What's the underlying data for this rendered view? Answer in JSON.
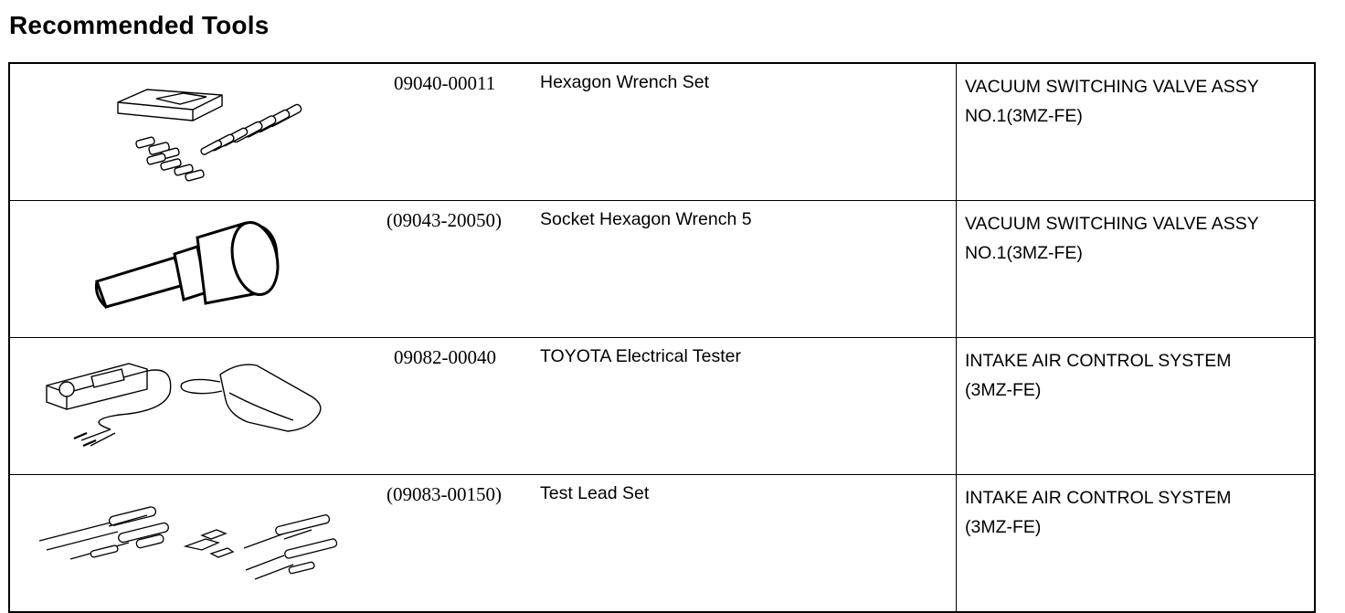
{
  "page": {
    "title": "Recommended Tools"
  },
  "tools": [
    {
      "part_number": "09040-00011",
      "name": "Hexagon Wrench Set",
      "usage": [
        "VACUUM SWITCHING VALVE ASSY",
        "NO.1(3MZ-FE)"
      ],
      "illustration": "hexagon-wrench-set-illustration"
    },
    {
      "part_number": "(09043-20050)",
      "name": "Socket Hexagon Wrench 5",
      "usage": [
        "VACUUM SWITCHING VALVE ASSY",
        "NO.1(3MZ-FE)"
      ],
      "illustration": "socket-hexagon-wrench-illustration"
    },
    {
      "part_number": "09082-00040",
      "name": "TOYOTA Electrical Tester",
      "usage": [
        "INTAKE AIR CONTROL SYSTEM",
        "(3MZ-FE)"
      ],
      "illustration": "electrical-tester-illustration"
    },
    {
      "part_number": "(09083-00150)",
      "name": "Test Lead Set",
      "usage": [
        "INTAKE AIR CONTROL SYSTEM",
        "(3MZ-FE)"
      ],
      "illustration": "test-lead-set-illustration"
    }
  ]
}
